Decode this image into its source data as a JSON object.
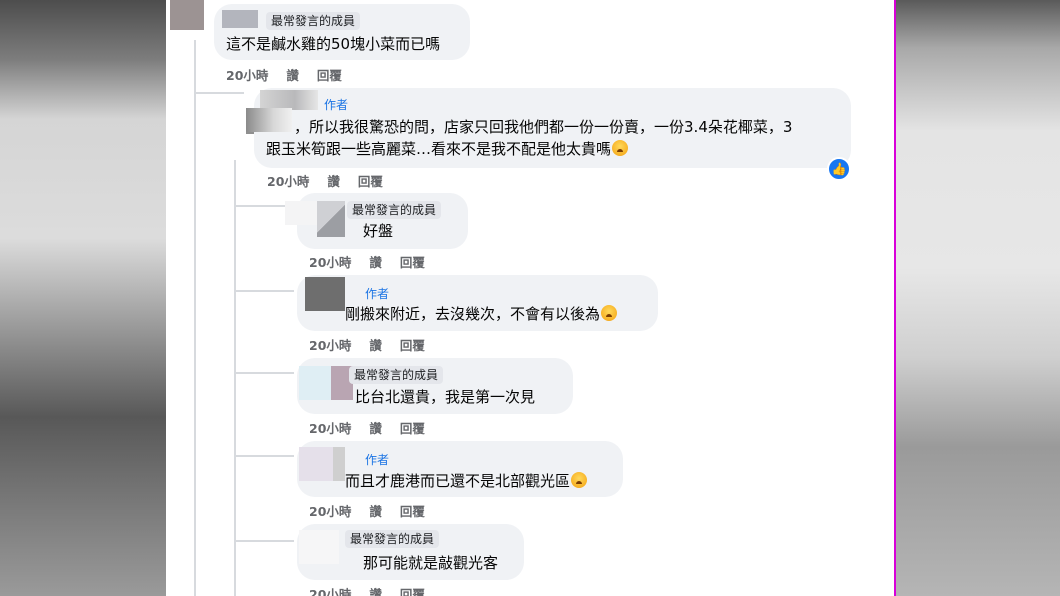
{
  "badge_label": "最常發言的成員",
  "author_label": "作者",
  "actions": {
    "time": "20小時",
    "like": "讚",
    "reply": "回覆"
  },
  "comments": [
    {
      "text": "這不是鹹水雞的50塊小菜而已嗎"
    },
    {
      "line1": "，所以我很驚恐的問，店家只回我他們都一份一份賣，一份3.4朵花椰菜，3",
      "line2": "跟玉米筍跟一些高麗菜…看來不是我不配是他太貴嗎"
    },
    {
      "text": "好盤"
    },
    {
      "text": "剛搬來附近，去沒幾次，不會有以後為"
    },
    {
      "text": "比台北還貴，我是第一次見"
    },
    {
      "text": "而且才鹿港而已還不是北部觀光區"
    },
    {
      "text": "那可能就是敲觀光客"
    }
  ],
  "emoji": "crying-face-icon",
  "like_reaction": "thumbs-up-icon"
}
